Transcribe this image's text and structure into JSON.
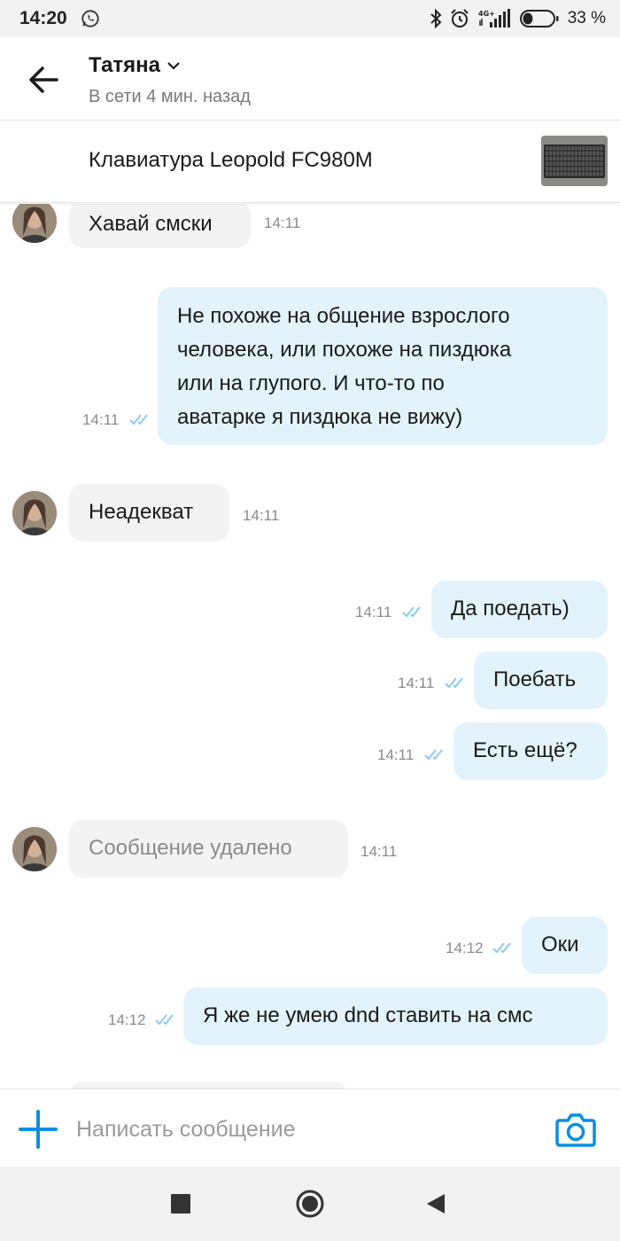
{
  "status_bar": {
    "time": "14:20",
    "left_icon": "whatsapp-icon",
    "right_icons": [
      "bluetooth-icon",
      "alarm-icon",
      "signal-4g-icon",
      "battery-icon"
    ],
    "network_label": "4G+",
    "battery_percent": "33 %",
    "battery_level": 0.33
  },
  "header": {
    "back_icon": "arrow-left-icon",
    "contact_name": "Татяна",
    "dropdown_icon": "chevron-down-icon",
    "contact_status": "В сети 4 мин. назад"
  },
  "listing": {
    "title": "Клавиатура Leopold FC980M",
    "thumbnail": "keyboard-photo"
  },
  "messages": [
    {
      "direction": "in",
      "text": "Хавай смски",
      "time": "14:11"
    },
    {
      "direction": "out",
      "lines": [
        "Не похоже на общение взрослого",
        "человека, или похоже на пиздюка",
        "или на глупого. И что-то по",
        "аватарке я пиздюка не вижу)"
      ],
      "time": "14:11",
      "read": true
    },
    {
      "direction": "in",
      "text": "Неадекват",
      "time": "14:11"
    },
    {
      "direction": "out",
      "text": "Да поедать)",
      "time": "14:11",
      "read": true
    },
    {
      "direction": "out",
      "text": "Поебать",
      "time": "14:11",
      "read": true
    },
    {
      "direction": "out",
      "text": "Есть ещё?",
      "time": "14:11",
      "read": true
    },
    {
      "direction": "in",
      "text": "Сообщение удалено",
      "time": "14:11",
      "deleted": true
    },
    {
      "direction": "out",
      "text": "Оки",
      "time": "14:12",
      "read": true
    },
    {
      "direction": "out",
      "text": "Я же не умею dnd ставить на смс",
      "time": "14:12",
      "read": true
    }
  ],
  "input_bar": {
    "add_icon": "plus-icon",
    "placeholder": "Написать сообщение",
    "value": "",
    "camera_icon": "camera-icon"
  },
  "nav_bar": {
    "icons": [
      "recent-apps-icon",
      "home-icon",
      "back-triangle-icon"
    ]
  },
  "colors": {
    "accent": "#0a8ee0",
    "incoming_bubble": "#f3f3f3",
    "outgoing_bubble": "#e3f3fc",
    "read_ticks": "#8ccbea"
  }
}
